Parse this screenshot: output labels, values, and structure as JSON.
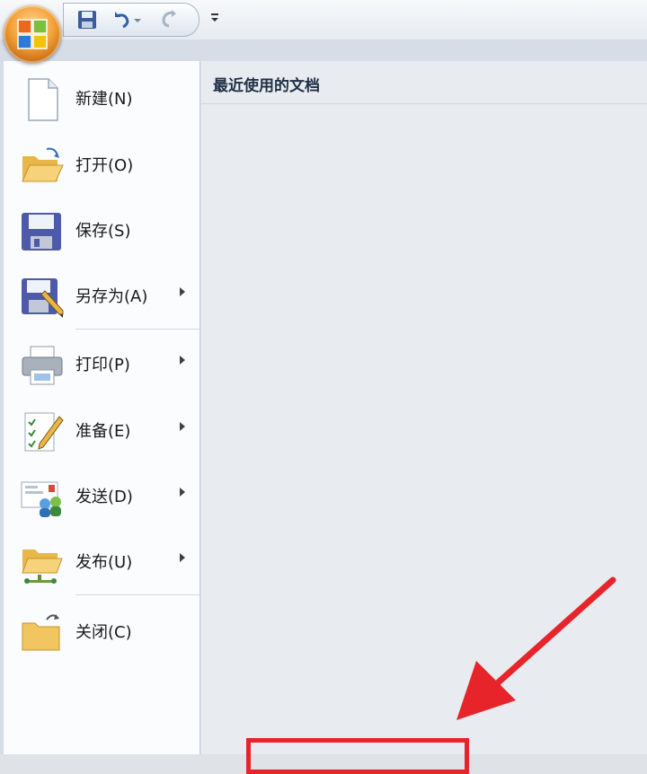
{
  "app": {
    "accent": "#f3a23a",
    "orb_icon": "office-logo-icon"
  },
  "quick_access": [
    {
      "name": "save-icon"
    },
    {
      "name": "undo-icon"
    },
    {
      "name": "redo-icon"
    },
    {
      "name": "customize-dropdown-icon"
    }
  ],
  "menu": {
    "items": [
      {
        "label": "新建(N)",
        "icon": "new-document-icon",
        "submenu": false
      },
      {
        "label": "打开(O)",
        "icon": "open-folder-icon",
        "submenu": false
      },
      {
        "label": "保存(S)",
        "icon": "save-icon",
        "submenu": false
      },
      {
        "label": "另存为(A)",
        "icon": "save-as-icon",
        "submenu": true
      },
      {
        "label": "打印(P)",
        "icon": "printer-icon",
        "submenu": true
      },
      {
        "label": "准备(E)",
        "icon": "prepare-icon",
        "submenu": true
      },
      {
        "label": "发送(D)",
        "icon": "send-icon",
        "submenu": true
      },
      {
        "label": "发布(U)",
        "icon": "publish-icon",
        "submenu": true
      },
      {
        "label": "关闭(C)",
        "icon": "close-folder-icon",
        "submenu": false
      }
    ]
  },
  "recent": {
    "title": "最近使用的文档"
  },
  "annotation": {
    "color": "#e8242b"
  }
}
